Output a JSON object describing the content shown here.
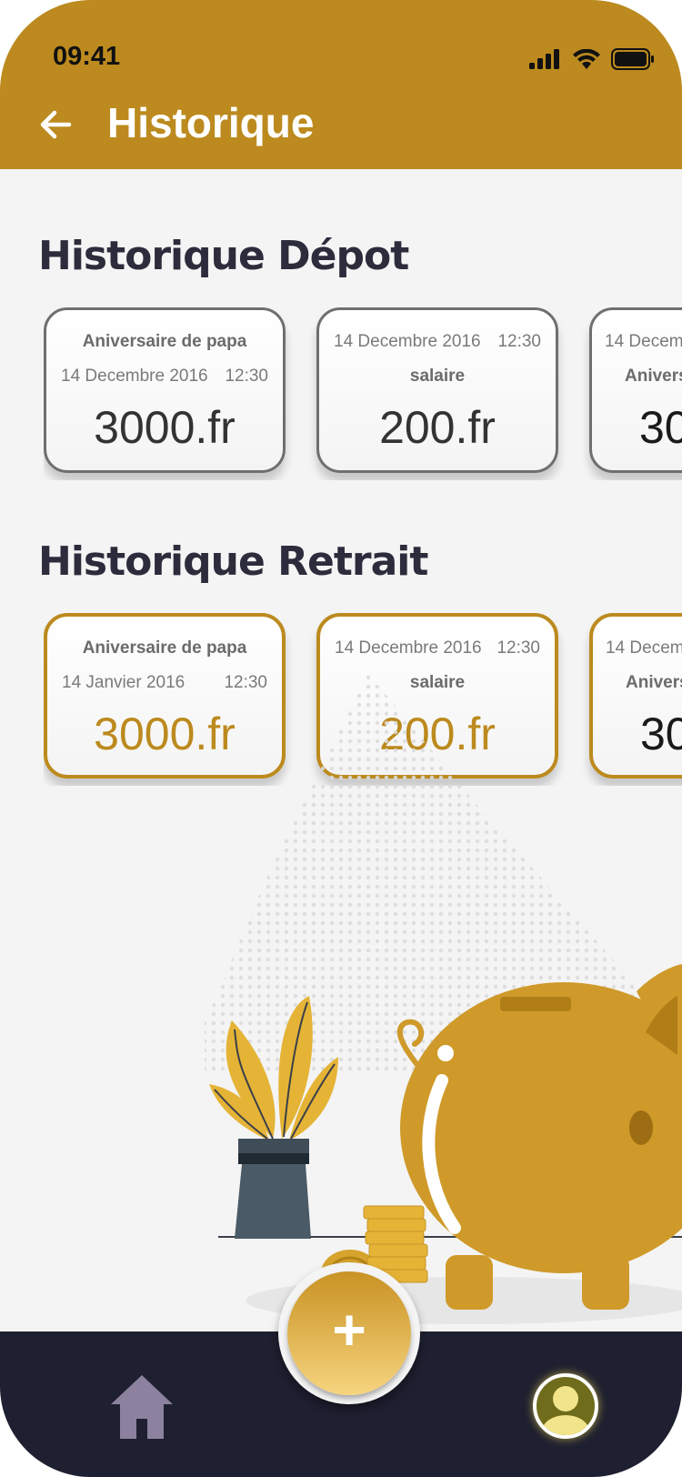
{
  "status_bar": {
    "time": "09:41"
  },
  "header": {
    "title": "Historique"
  },
  "depot": {
    "title": "Historique Dépot",
    "cards": [
      {
        "label": "Aniversaire de papa",
        "date": "14 Decembre 2016",
        "time": "12:30",
        "amount": "3000.fr"
      },
      {
        "date": "14 Decembre 2016",
        "time": "12:30",
        "label": "salaire",
        "amount": "200.fr"
      },
      {
        "date": "14 Decem",
        "label": "Anivers",
        "amount": "30"
      }
    ]
  },
  "retrait": {
    "title": "Historique Retrait",
    "cards": [
      {
        "label": "Aniversaire de papa",
        "date": "14 Janvier 2016",
        "time": "12:30",
        "amount": "3000.fr"
      },
      {
        "date": "14 Decembre 2016",
        "time": "12:30",
        "label": "salaire",
        "amount": "200.fr"
      },
      {
        "date": "14 Decem",
        "label": "Anivers",
        "amount": "30"
      }
    ]
  },
  "fab": {
    "label": "+"
  },
  "colors": {
    "header": "#bc8a1e",
    "accent": "#bc8a1e",
    "bottom_bar": "#1e1f30"
  },
  "icons": [
    "back-arrow-icon",
    "signal-icon",
    "wifi-icon",
    "battery-icon",
    "home-icon",
    "profile-icon",
    "plus-icon"
  ]
}
